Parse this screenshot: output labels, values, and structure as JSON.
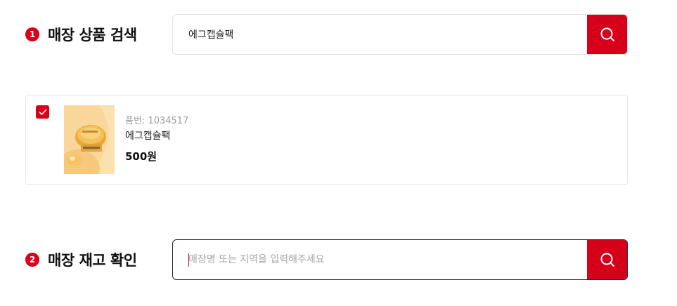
{
  "section1": {
    "number": "1",
    "title": "매장 상품 검색",
    "search": {
      "value": "에그캡슐팩",
      "placeholder": "",
      "button_icon": "search-icon"
    }
  },
  "product": {
    "checked": true,
    "code_label": "품번: 1034517",
    "name": "에그캡슐팩",
    "price": "500원"
  },
  "section2": {
    "number": "2",
    "title": "매장 재고 확인",
    "search": {
      "value": "",
      "placeholder": "매장명 또는 지역을 입력해주세요",
      "button_icon": "search-icon"
    }
  },
  "colors": {
    "accent": "#d7001a",
    "border": "#e2e2e2",
    "muted": "#9b9b9b"
  }
}
